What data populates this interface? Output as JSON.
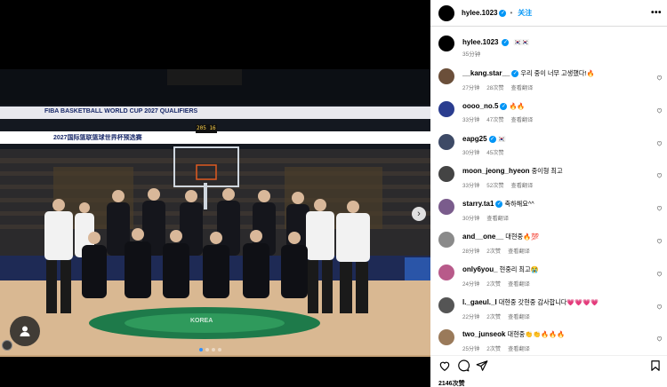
{
  "post": {
    "author": "hylee.1023",
    "follow_label": "关注",
    "more_label": "•••",
    "caption_text": "🇰🇷🇰🇷",
    "caption_time": "35分钟",
    "likes": "2146次赞"
  },
  "photo": {
    "banner_upper": "FIBA BASKETBALL WORLD CUP 2027 QUALIFIERS",
    "banner_lower": "2027国际篮联篮球世界杯预选赛",
    "scoreboard": "205 16",
    "court_logo": "KOREA",
    "next_arrow": "›"
  },
  "comments": [
    {
      "user": "__kang.star__",
      "verified": true,
      "text": "우리 중이 너무 고생했다!🔥",
      "time": "27分钟",
      "likes": "28次赞",
      "translate": "查看翻译",
      "avatar_color": "#6b4f3a"
    },
    {
      "user": "oooo_no.5",
      "verified": true,
      "text": "🔥🔥",
      "time": "33分钟",
      "likes": "47次赞",
      "translate": "查看翻译",
      "avatar_color": "#2a3d8f"
    },
    {
      "user": "eapg25",
      "verified": true,
      "text": "🇰🇷",
      "time": "30分钟",
      "likes": "45次赞",
      "translate": "",
      "avatar_color": "#3d4a66"
    },
    {
      "user": "moon_jeong_hyeon",
      "verified": false,
      "text": "중이형 최고",
      "time": "33分钟",
      "likes": "52次赞",
      "translate": "查看翻译",
      "avatar_color": "#444444"
    },
    {
      "user": "starry.ta1",
      "verified": true,
      "text": "축하해요^^",
      "time": "30分钟",
      "likes": "",
      "translate": "查看翻译",
      "avatar_color": "#7a5c8c"
    },
    {
      "user": "and__one__",
      "verified": false,
      "text": "대현중🔥💯",
      "time": "28分钟",
      "likes": "2次赞",
      "translate": "查看翻译",
      "avatar_color": "#8a8a8a"
    },
    {
      "user": "only6you_",
      "verified": false,
      "text": "현중리 최고😭",
      "time": "24分钟",
      "likes": "2次赞",
      "translate": "查看翻译",
      "avatar_color": "#b85a8a"
    },
    {
      "user": "l._gaeul._l",
      "verified": false,
      "text": "대현중 갓현중 감사합니다💗💗💗💗",
      "time": "22分钟",
      "likes": "2次赞",
      "translate": "查看翻译",
      "avatar_color": "#555555"
    },
    {
      "user": "two_junseok",
      "verified": false,
      "text": "대현중👏👏🔥🔥🔥",
      "time": "25分钟",
      "likes": "2次赞",
      "translate": "查看翻译",
      "avatar_color": "#9a7a5a"
    }
  ],
  "colors": {
    "accent": "#0095f6",
    "secondary_text": "#737373",
    "border": "#dbdbdb"
  },
  "icons": [
    "heart-icon",
    "comment-icon",
    "share-icon",
    "bookmark-icon",
    "person-icon",
    "verified-icon"
  ]
}
